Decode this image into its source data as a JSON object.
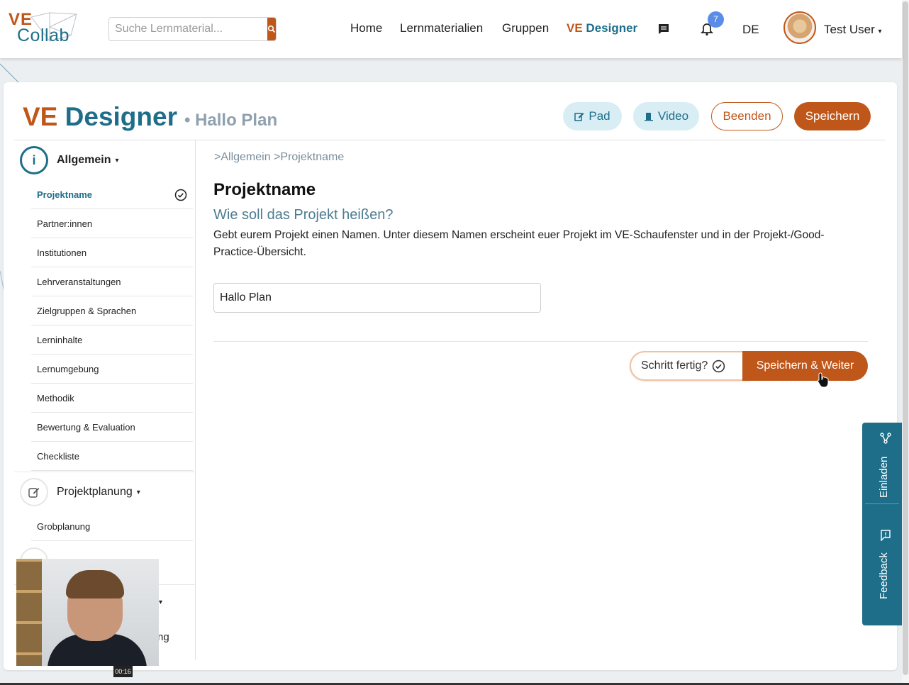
{
  "header": {
    "logo_ve": "VE",
    "logo_collab": "Collab",
    "search_placeholder": "Suche Lernmaterial...",
    "nav": [
      "Home",
      "Lernmaterialien",
      "Gruppen"
    ],
    "nav_active_ve": "VE",
    "nav_active_designer": "Designer",
    "notification_count": "7",
    "language": "DE",
    "user_name": "Test User"
  },
  "page": {
    "title_ve": "VE",
    "title_designer": "Designer",
    "plan_name": "• Hallo Plan",
    "buttons": {
      "pad": "Pad",
      "video": "Video",
      "end": "Beenden",
      "save": "Speichern"
    }
  },
  "sidebar": {
    "section1": "Allgemein",
    "section1_items": [
      "Projektname",
      "Partner:innen",
      "Institutionen",
      "Lehrveranstaltungen",
      "Zielgruppen & Sprachen",
      "Lerninhalte",
      "Lernumgebung",
      "Methodik",
      "Bewertung & Evaluation",
      "Checkliste"
    ],
    "section2": "Projektplanung",
    "section2_items": [
      "Grobplanung"
    ],
    "partial_label": "ng"
  },
  "main": {
    "breadcrumb1": "Allgemein",
    "breadcrumb2": "Projektname",
    "heading": "Projektname",
    "question": "Wie soll das Projekt heißen?",
    "description": "Gebt eurem Projekt einen Namen. Unter diesem Namen erscheint euer Projekt im VE-Schaufenster und in der Projekt-/Good-Practice-Übersicht.",
    "input_value": "Hallo Plan",
    "step_done": "Schritt fertig?",
    "save_next": "Speichern & Weiter"
  },
  "sidetabs": {
    "invite": "Einladen",
    "feedback": "Feedback"
  },
  "video_timer": "00:16",
  "colors": {
    "accent_orange": "#c0571a",
    "accent_teal": "#1e6e8a"
  }
}
